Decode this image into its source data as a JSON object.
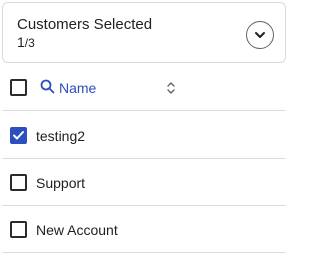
{
  "summary": {
    "title": "Customers Selected",
    "selected_count": "1",
    "total_count": "/3"
  },
  "table": {
    "header": {
      "column_label": "Name"
    },
    "rows": [
      {
        "label": "testing2",
        "checked": true
      },
      {
        "label": "Support",
        "checked": false
      },
      {
        "label": "New Account",
        "checked": false
      }
    ]
  },
  "colors": {
    "accent": "#2d4ec0",
    "border": "#d9dadc"
  },
  "icons": {
    "expand": "chevron-down-icon",
    "search": "search-icon",
    "sort": "sort-icon",
    "check": "check-icon"
  }
}
